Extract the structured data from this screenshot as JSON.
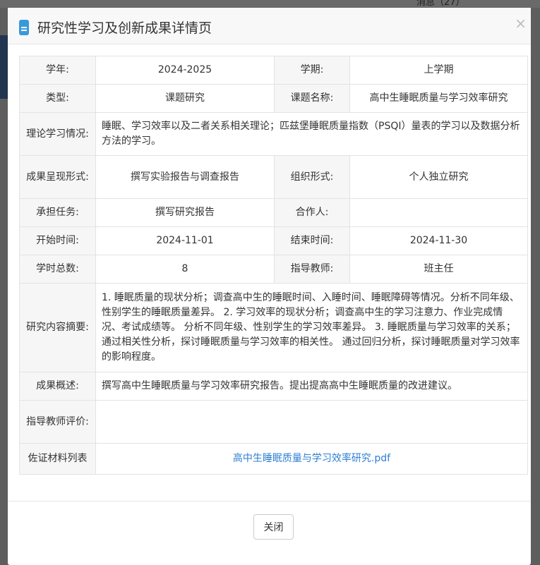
{
  "background": {
    "messages": "消息（27）"
  },
  "dialog": {
    "title": "研究性学习及创新成果详情页",
    "close_label": "关闭"
  },
  "fields": {
    "year_label": "学年:",
    "year": "2024-2025",
    "term_label": "学期:",
    "term": "上学期",
    "type_label": "类型:",
    "type": "课题研究",
    "topic_label": "课题名称:",
    "topic": "高中生睡眠质量与学习效率研究",
    "theory_label": "理论学习情况:",
    "theory": "睡眠、学习效率以及二者关系相关理论；匹兹堡睡眠质量指数（PSQI）量表的学习以及数据分析方法的学习。",
    "form_label": "成果呈现形式:",
    "form": "撰写实验报告与调查报告",
    "org_label": "组织形式:",
    "org": "个人独立研究",
    "task_label": "承担任务:",
    "task": "撰写研究报告",
    "partner_label": "合作人:",
    "partner": "",
    "start_label": "开始时间:",
    "start": "2024-11-01",
    "end_label": "结束时间:",
    "end": "2024-11-30",
    "hours_label": "学时总数:",
    "hours": "8",
    "teacher_label": "指导教师:",
    "teacher": "班主任",
    "abstract_label": "研究内容摘要:",
    "abstract": "1. 睡眠质量的现状分析；调查高中生的睡眠时间、入睡时间、睡眠障碍等情况。分析不同年级、性别学生的睡眠质量差异。 2. 学习效率的现状分析；调查高中生的学习注意力、作业完成情况、考试成绩等。 分析不同年级、性别学生的学习效率差异。 3. 睡眠质量与学习效率的关系；通过相关性分析，探讨睡眠质量与学习效率的相关性。 通过回归分析，探讨睡眠质量对学习效率的影响程度。",
    "summary_label": "成果概述:",
    "summary": "撰写高中生睡眠质量与学习效率研究报告。提出提高高中生睡眠质量的改进建议。",
    "comment_label": "指导教师评价:",
    "comment": "",
    "evidence_label": "佐证材料列表",
    "evidence_file": "高中生睡眠质量与学习效率研究.pdf"
  }
}
